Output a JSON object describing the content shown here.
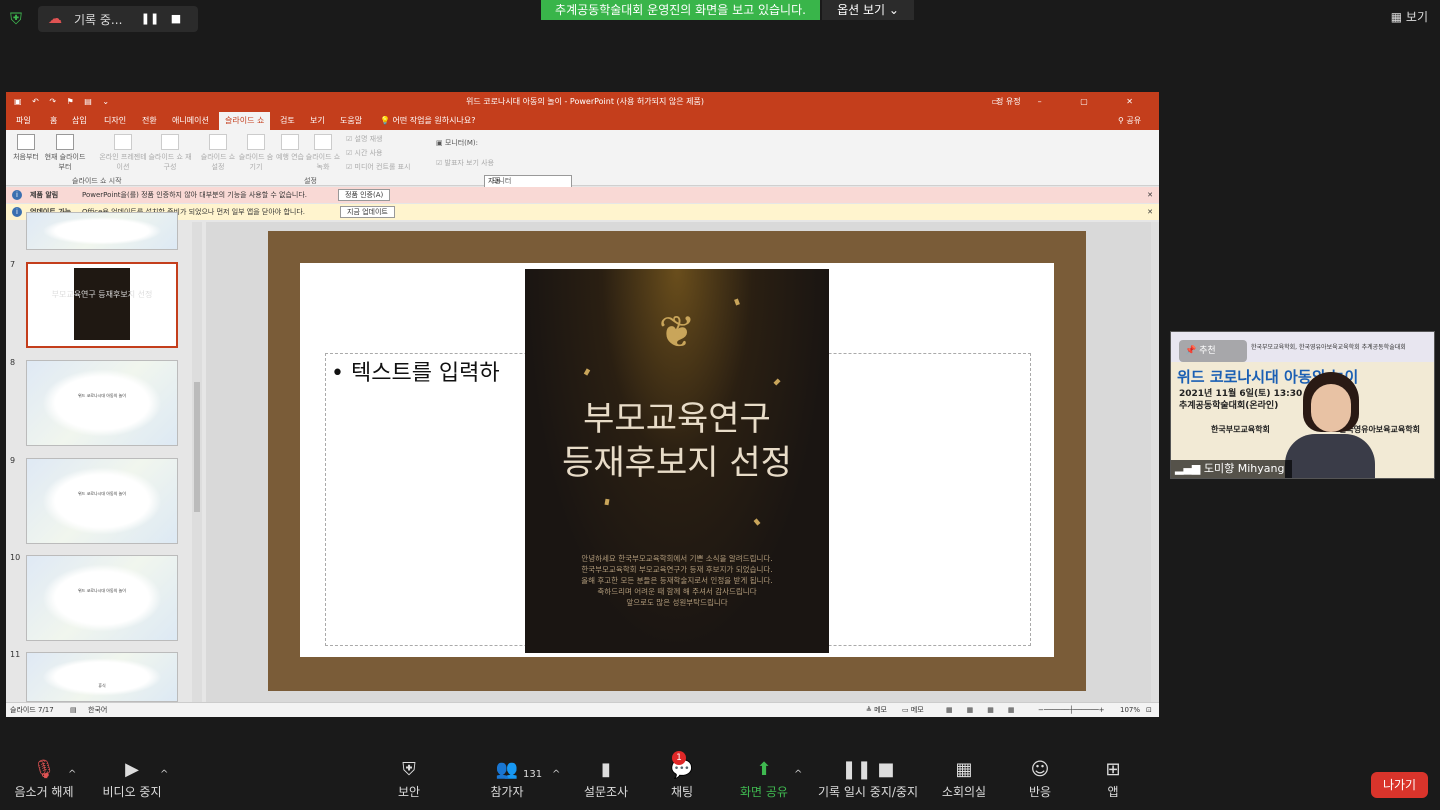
{
  "zoom": {
    "recording_label": "기록 중...",
    "share_banner": "추계공동학술대회 운영진의 화면을 보고 있습니다.",
    "view_options": "옵션 보기 ⌄",
    "view_button": "보기",
    "participant_count": "131",
    "chat_badge": "1",
    "toolbar": {
      "mute": "음소거 해제",
      "video": "비디오 중지",
      "security": "보안",
      "participants": "참가자",
      "polls": "설문조사",
      "chat": "채팅",
      "share": "화면 공유",
      "record": "기록 일시 중지/중지",
      "breakout": "소회의실",
      "reactions": "반응",
      "apps": "앱",
      "leave": "나가기"
    }
  },
  "ppt": {
    "window_title": "위드 코로나시대 아동의 놀이 - PowerPoint (사용 허가되지 않은 제품)",
    "user": "정 유정",
    "share_label": "공유",
    "tell_me": "어떤 작업을 원하시나요?",
    "tabs": [
      "파일",
      "홈",
      "삽입",
      "디자인",
      "전환",
      "애니메이션",
      "슬라이드 쇼",
      "검토",
      "보기",
      "도움말"
    ],
    "ribbon": {
      "from_beginning": "처음부터",
      "from_current": "현재 슬라이드부터",
      "online": "온라인 프레젠테이션",
      "custom": "슬라이드 쇼 재구성",
      "group_start": "슬라이드 쇼 시작",
      "setup": "슬라이드 쇼 설정",
      "hide": "슬라이드 숨기기",
      "rehearse": "예행 연습",
      "record": "슬라이드 쇼 녹화",
      "chk_narration": "설명 재생",
      "chk_timing": "시간 사용",
      "chk_media": "미디어 컨트롤 표시",
      "group_setup": "설정",
      "monitor_label": "모니터(M):",
      "monitor_value": "자동",
      "presenter_view": "발표자 보기 사용",
      "group_monitor": "모니터"
    },
    "msg1": {
      "title": "제품 알림",
      "text": "PowerPoint을(를) 정품 인증하지 않아 대부분의 기능을 사용할 수 없습니다.",
      "button": "정품 인증(A)"
    },
    "msg2": {
      "title": "업데이트 가능",
      "text": "Office용 업데이트를 설치할 준비가 되었으나 먼저 일부 앱을 닫아야 합니다.",
      "button": "지금 업데이트"
    },
    "thumbnails": [
      {
        "num": "7",
        "text": "부모교육연구 등재후보지 선정"
      },
      {
        "num": "8",
        "text": "위드 코로나시대 아동의 놀이"
      },
      {
        "num": "9",
        "text": "위드 코로나시대 아동의 놀이"
      },
      {
        "num": "10",
        "text": "위드 코로나시대 아동의 놀이"
      },
      {
        "num": "11",
        "text": "휴식"
      }
    ],
    "slide": {
      "bullet": "• 텍스트를 입력하",
      "poster_title_1": "부모교육연구",
      "poster_title_2": "등재후보지 선정",
      "poster_lines": [
        "안녕하세요 한국부모교육학회에서 기쁜 소식을 알려드립니다.",
        "한국부모교육학회 부모교육연구가 등재 후보지가 되었습니다.",
        "올해 후고한 모든 분들은 등재학술지로서 인정을 받게 됩니다.",
        "축하드리며 어려운 때 함께 해 주셔서 감사드립니다",
        "앞으로도 많은 성원부탁드립니다"
      ]
    },
    "status": {
      "slide_num": "슬라이드 7/17",
      "language": "한국어",
      "notes": "메모",
      "comments": "메모",
      "zoom": "107%"
    }
  },
  "video_tile": {
    "pin_label": "추천",
    "banner": "한국부모교육학회, 한국영유아보육교육학회 추계공동학술대회",
    "title": "위드 코로나시대 아동의 놀이",
    "date": "2021년 11월 6일(토) 13:30",
    "subtitle": "추계공동학술대회(온라인)",
    "org1": "한국부모교육학회",
    "org2": "한국영유아보육교육학회",
    "name": "도미향 Mihyang"
  }
}
